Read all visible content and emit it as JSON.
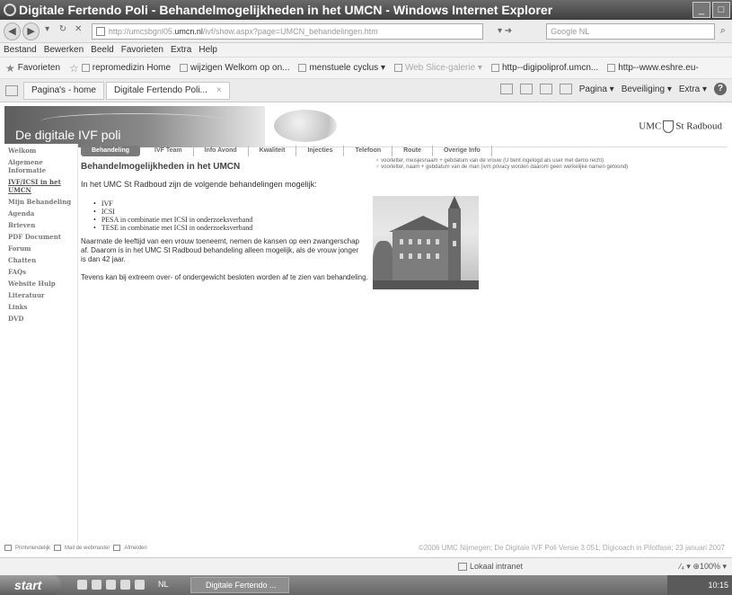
{
  "window": {
    "title": "Digitale Fertendo Poli - Behandelmogelijkheden in het UMCN - Windows Internet Explorer",
    "minimize": "_",
    "maximize": "□"
  },
  "address": {
    "url_prefix": "http://umcsbgnl05.",
    "url_domain": "umcn.nl",
    "url_suffix": "/ivf/show.aspx?page=UMCN_behandelingen.htm",
    "search_placeholder": "Google NL"
  },
  "menu": [
    "Bestand",
    "Bewerken",
    "Beeld",
    "Favorieten",
    "Extra",
    "Help"
  ],
  "favorites": {
    "label": "Favorieten",
    "items": [
      {
        "label": "repromedizin Home",
        "faded": false
      },
      {
        "label": "wijzigen Welkom op on...",
        "faded": false
      },
      {
        "label": "menstuele cyclus ▾",
        "faded": false
      },
      {
        "label": "Web Slice-galerie ▾",
        "faded": true
      },
      {
        "label": "http--digipoliprof.umcn...",
        "faded": false
      },
      {
        "label": "http--www.eshre.eu-",
        "faded": false
      }
    ]
  },
  "tabs": {
    "items": [
      {
        "label": "Pagina's - home",
        "active": false
      },
      {
        "label": "Digitale Fertendo Poli...",
        "active": true
      }
    ],
    "close": "×",
    "commands": [
      "Pagina ▾",
      "Beveiliging ▾",
      "Extra ▾"
    ],
    "help": "?"
  },
  "banner": {
    "brand": "De digitale IVF poli",
    "hospital_left": "UMC",
    "hospital_right": "St Radboud"
  },
  "leftnav": [
    {
      "label": "Welkom",
      "current": false
    },
    {
      "label": "Algemene Informatie",
      "current": false
    },
    {
      "label": "IVF/ICSI in het UMCN",
      "current": true
    },
    {
      "label": "Mijn Behandeling",
      "current": false
    },
    {
      "label": "Agenda",
      "current": false
    },
    {
      "label": "Brieven",
      "current": false
    },
    {
      "label": "PDF Document",
      "current": false
    },
    {
      "label": "Forum",
      "current": false
    },
    {
      "label": "Chatten",
      "current": false
    },
    {
      "label": "FAQs",
      "current": false
    },
    {
      "label": "Website Hulp",
      "current": false
    },
    {
      "label": "Literatuur",
      "current": false
    },
    {
      "label": "Links",
      "current": false
    },
    {
      "label": "DVD",
      "current": false
    }
  ],
  "navtabs": [
    {
      "label": "Behandeling",
      "active": true
    },
    {
      "label": "IVF Team",
      "active": false
    },
    {
      "label": "Info Avond",
      "active": false
    },
    {
      "label": "Kwaliteit",
      "active": false
    },
    {
      "label": "Injecties",
      "active": false
    },
    {
      "label": "Telefoon",
      "active": false
    },
    {
      "label": "Route",
      "active": false
    },
    {
      "label": "Overige Info",
      "active": false
    }
  ],
  "content": {
    "title": "Behandelmogelijkheden in het UMCN",
    "login_hint_1": "♀ voorletter, meisjesnaam + gebdatum van de vrouw (U bent ingelogd als user met demo recht)",
    "login_hint_2": "♂ voorletter, naam + gebdatum van de man (ivm privacy worden daarom geen werkelijke namen getoond)",
    "intro": "In het UMC St Radboud zijn de volgende behandelingen mogelijk:",
    "treatments": [
      "IVF",
      "ICSI",
      "PESA in combinatie met ICSI in onderzoeksverband",
      "TESE in combinatie met ICSI in onderzoeksverband"
    ],
    "para1": "Naarmate de leeftijd van een vrouw toeneemt, nemen de kansen op een zwangerschap af. Daarom is in het UMC St Radboud behandeling alleen mogelijk, als de vrouw jonger is dan 42 jaar.",
    "para2": "Tevens kan bij extreem over- of ondergewicht besloten worden af te zien van behandeling."
  },
  "footer": {
    "print": "Printvriendelijk",
    "mail": "Mail de webmaster",
    "logout": "Afmelden",
    "copyright": "©2006 UMC Nijmegen; De Digitale IVF Poli Versie 3.051; Digicoach in Pilotfase; 23 januari 2007"
  },
  "status": {
    "zone": "Lokaal intranet",
    "zoom": "⁄₄ ▾  ⊕100% ▾"
  },
  "taskbar": {
    "start": "start",
    "lang": "NL",
    "task": "Digitale Fertendo ...",
    "clock": "10:15"
  }
}
